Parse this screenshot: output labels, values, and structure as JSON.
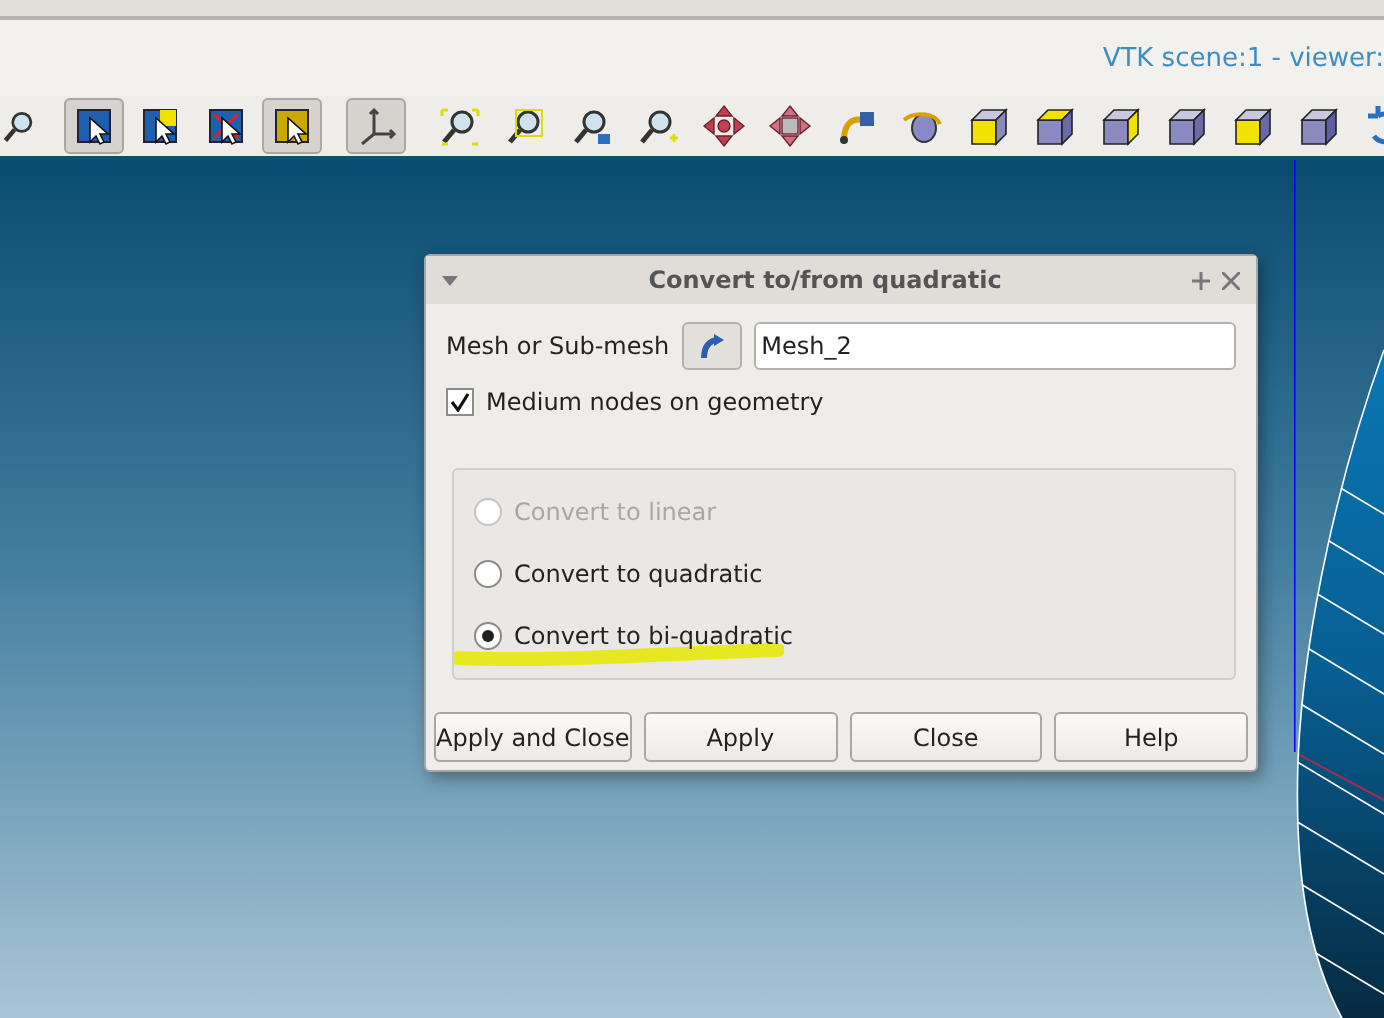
{
  "viewer": {
    "title": "VTK scene:1 - viewer:"
  },
  "toolbar": {
    "buttons": [
      {
        "kind": "magnifier-cut",
        "selected": false
      },
      {
        "kind": "select-blue",
        "selected": true
      },
      {
        "kind": "select-split",
        "selected": false
      },
      {
        "kind": "select-cross",
        "selected": false
      },
      {
        "kind": "select-yellow",
        "selected": true
      },
      {
        "kind": "axes",
        "selected": true
      },
      {
        "kind": "zoom-fit",
        "selected": false
      },
      {
        "kind": "zoom-window",
        "selected": false
      },
      {
        "kind": "zoom-selection",
        "selected": false
      },
      {
        "kind": "zoom",
        "selected": false
      },
      {
        "kind": "pan",
        "selected": false
      },
      {
        "kind": "pan-global",
        "selected": false
      },
      {
        "kind": "rotate-point",
        "selected": false
      },
      {
        "kind": "rotate",
        "selected": false
      },
      {
        "kind": "cube-front",
        "selected": false
      },
      {
        "kind": "cube-top",
        "selected": false
      },
      {
        "kind": "cube-left",
        "selected": false
      },
      {
        "kind": "cube-bottom",
        "selected": false
      },
      {
        "kind": "cube-right",
        "selected": false
      },
      {
        "kind": "cube-back",
        "selected": false
      },
      {
        "kind": "undo",
        "selected": false
      }
    ]
  },
  "dialog": {
    "title": "Convert to/from quadratic",
    "mesh_label": "Mesh or Sub-mesh",
    "mesh_value": "Mesh_2",
    "medium_nodes": {
      "label": "Medium nodes on geometry",
      "checked": true
    },
    "options": [
      {
        "label": "Convert to linear",
        "selected": false,
        "disabled": true,
        "highlighted": false
      },
      {
        "label": "Convert to quadratic",
        "selected": false,
        "disabled": false,
        "highlighted": false
      },
      {
        "label": "Convert to bi-quadratic",
        "selected": true,
        "disabled": false,
        "highlighted": true
      }
    ],
    "buttons": [
      "Apply and Close",
      "Apply",
      "Close",
      "Help"
    ]
  }
}
